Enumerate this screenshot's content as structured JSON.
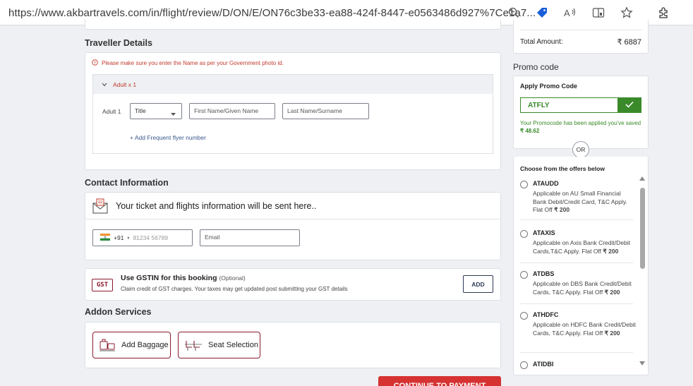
{
  "browser": {
    "url": "https://www.akbartravels.com/in/flight/review/D/ON/E/ON76c3be33-ea88-424f-8447-e0563486d927%7Ce1a7..."
  },
  "traveller": {
    "title": "Traveller Details",
    "notice": "Please make sure you enter the Name as per your Government photo id.",
    "adult_header": "Adult x 1",
    "adult_label": "Adult 1",
    "title_select": "Title",
    "first_name_placeholder": "First Name/Given Name",
    "last_name_placeholder": "Last Name/Surname",
    "frequent_flyer": "+ Add Frequent flyer number"
  },
  "contact": {
    "title": "Contact Information",
    "info_text": "Your ticket and flights information will be sent here..",
    "country_code": "+91",
    "phone_placeholder": "81234 56789",
    "email_placeholder": "Email"
  },
  "gst": {
    "logo": "GST",
    "title": "Use GSTIN for this booking",
    "optional": "(Optional)",
    "desc": "Claim credit of GST charges. Your taxes may get updated post submitting your GST details",
    "add_label": "ADD"
  },
  "addons": {
    "title": "Addon Services",
    "baggage": "Add Baggage",
    "seat": "Seat Selection"
  },
  "continue_label": "CONTINUE TO PAYMENT",
  "summary": {
    "total_label": "Total Amount:",
    "total_value": "₹ 6887"
  },
  "promo": {
    "title": "Promo code",
    "apply_label": "Apply Promo Code",
    "code_value": "ATFLY",
    "success_msg": "Your Promocode has been applied you've saved",
    "saved_amount": "₹ 48.62",
    "or_label": "OR",
    "choose_label": "Choose from the offers below",
    "offers": [
      {
        "code": "ATAUDD",
        "desc": "Applicable on AU Small Financial Bank Debit/Credit Card, T&C Apply. Flat Off",
        "amount": "₹ 200"
      },
      {
        "code": "ATAXIS",
        "desc": "Applicable on Axis Bank Credit/Debit Cards,T&C Apply. Flat Off",
        "amount": "₹ 200"
      },
      {
        "code": "ATDBS",
        "desc": "Applicable on DBS Bank Credit/Debit Cards, T&C Apply. Flat Off",
        "amount": "₹ 200"
      },
      {
        "code": "ATHDFC",
        "desc": "Applicable on HDFC Bank Credit/Debit Cards, T&C Apply. Flat Off",
        "amount": "₹ 200"
      },
      {
        "code": "ATIDBI",
        "desc": "",
        "amount": ""
      }
    ]
  },
  "colors": {
    "accent_red": "#d63232",
    "promo_green": "#3a8a2a",
    "navy": "#2d3a55"
  }
}
